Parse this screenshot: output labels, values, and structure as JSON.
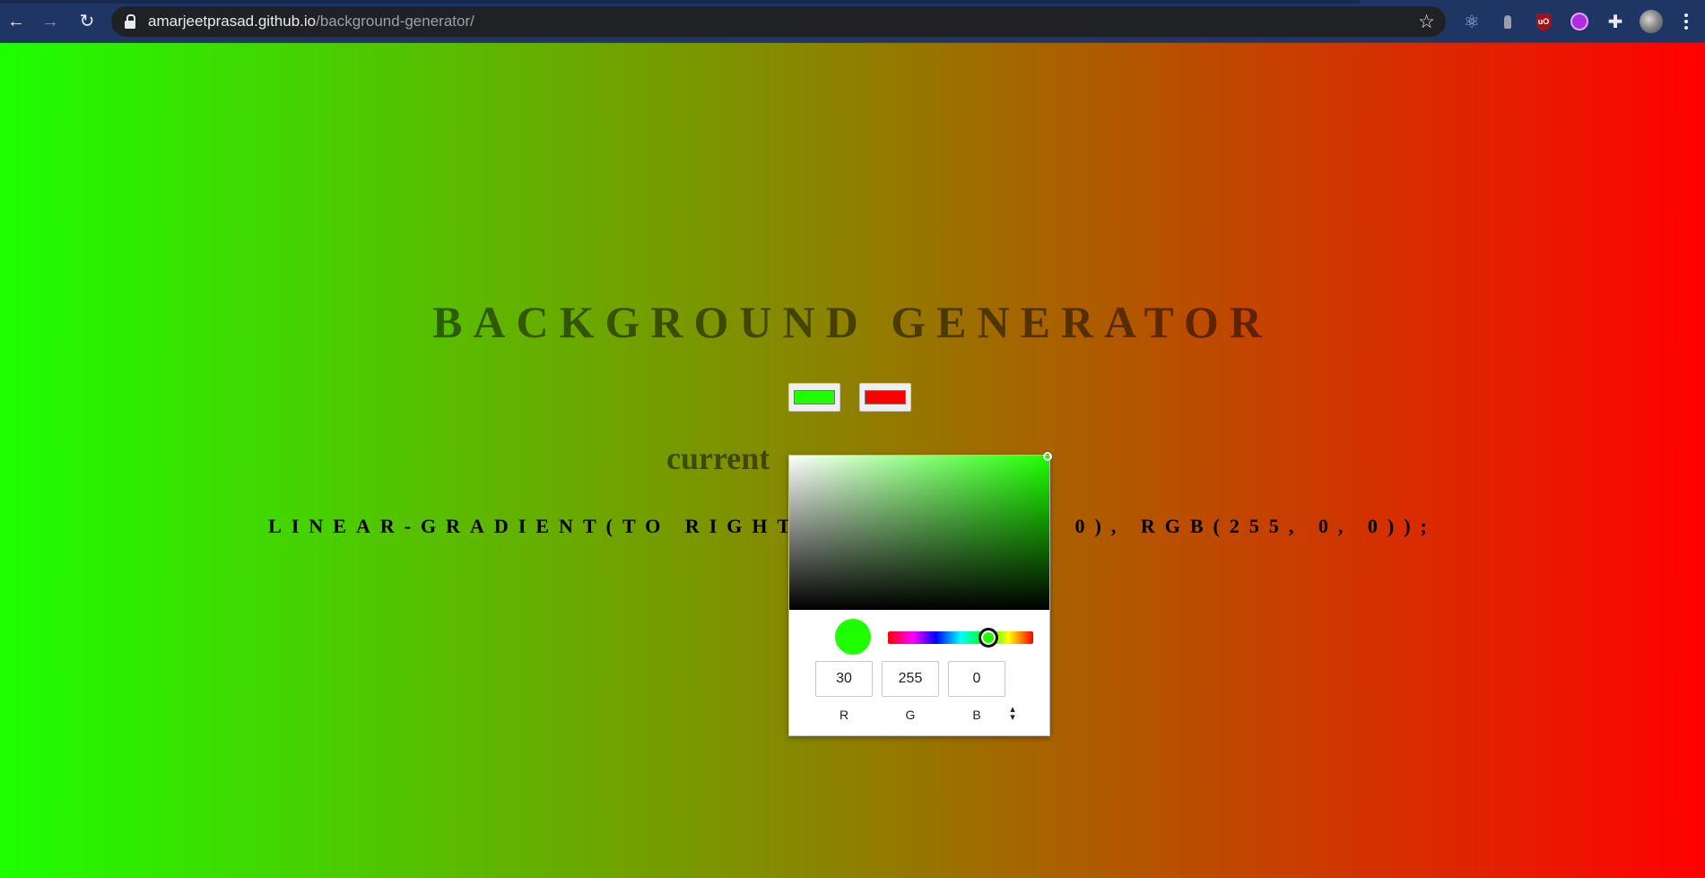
{
  "browser": {
    "url_host": "amarjeetprasad.github.io",
    "url_path": "/background-generator/",
    "back_icon": "←",
    "forward_icon": "→",
    "reload_icon": "↻",
    "star_icon": "☆",
    "react_icon": "⚛",
    "puzzle_icon": "✚",
    "ublock_text": "uO"
  },
  "page": {
    "title": "BACKGROUND GENERATOR",
    "subtitle": "current",
    "css_output": "LINEAR-GRADIENT(TO RIGHT, RGB(30, 255, 0), RGB(255, 0, 0));",
    "color1": "#1eff00",
    "color2": "#ff0000"
  },
  "picker": {
    "r_value": "30",
    "g_value": "255",
    "b_value": "0",
    "r_label": "R",
    "g_label": "G",
    "b_label": "B",
    "toggle_icon": "⌃⌄"
  }
}
